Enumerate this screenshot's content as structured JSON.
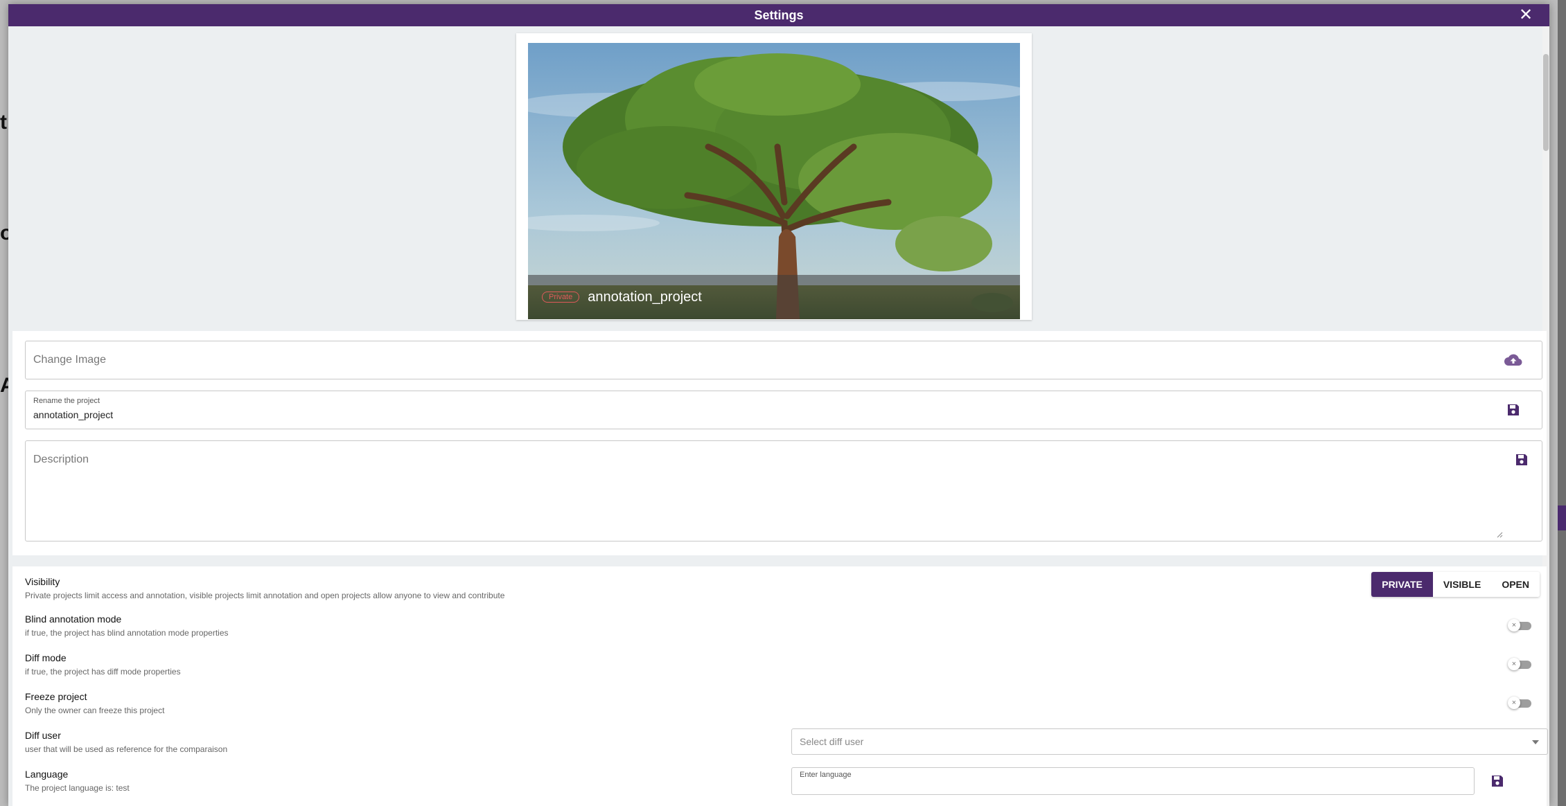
{
  "modal": {
    "title": "Settings",
    "close_glyph": "✕"
  },
  "project_card": {
    "badge": "Private",
    "name": "annotation_project",
    "image_subject": "tree-landscape"
  },
  "form": {
    "change_image_placeholder": "Change Image",
    "rename_label": "Rename the project",
    "rename_value": "annotation_project",
    "description_placeholder": "Description"
  },
  "settings": {
    "visibility": {
      "title": "Visibility",
      "description": "Private projects limit access and annotation, visible projects limit annotation and open projects allow anyone to view and contribute",
      "options": [
        "PRIVATE",
        "VISIBLE",
        "OPEN"
      ],
      "selected": "PRIVATE"
    },
    "blind": {
      "title": "Blind annotation mode",
      "description": "if true, the project has blind annotation mode properties",
      "enabled": false
    },
    "diff": {
      "title": "Diff mode",
      "description": "if true, the project has diff mode properties",
      "enabled": false
    },
    "freeze": {
      "title": "Freeze project",
      "description": "Only the owner can freeze this project",
      "enabled": false
    },
    "diff_user": {
      "title": "Diff user",
      "description": "user that will be used as reference for the comparaison",
      "placeholder": "Select diff user"
    },
    "language": {
      "title": "Language",
      "description": "The project language is: test",
      "field_label": "Enter language"
    }
  },
  "colors": {
    "brand": "#4b2a6d",
    "badge": "#e05a5a"
  },
  "icons": {
    "upload": "cloud-upload-icon",
    "save": "save-icon",
    "close": "close-icon",
    "toggle_off": "x-icon",
    "caret": "chevron-down-icon"
  }
}
